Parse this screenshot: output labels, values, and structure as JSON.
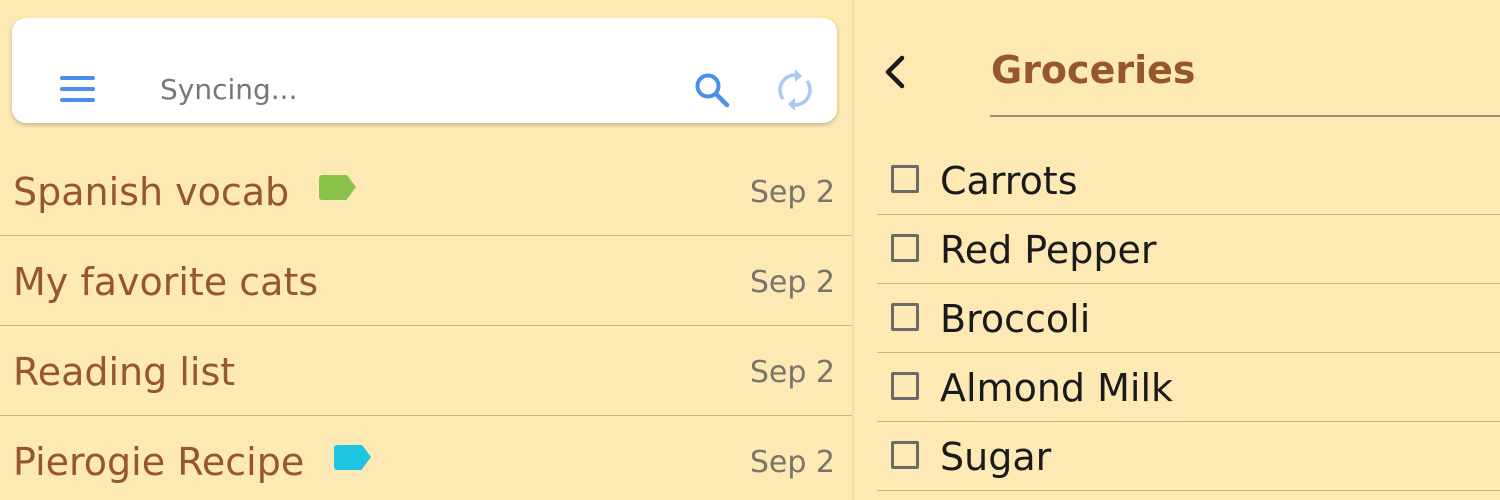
{
  "search_bar": {
    "status_text": "Syncing...",
    "menu_icon": "menu-icon",
    "search_icon": "search-icon",
    "sync_icon": "sync-icon",
    "accent_color": "#4a8ef0"
  },
  "notes": [
    {
      "title": "Spanish vocab",
      "date": "Sep 2",
      "tag_color": "#8bc34a"
    },
    {
      "title": "My favorite cats",
      "date": "Sep 2",
      "tag_color": null
    },
    {
      "title": "Reading list",
      "date": "Sep 2",
      "tag_color": null
    },
    {
      "title": "Pierogie Recipe",
      "date": "Sep 2",
      "tag_color": "#1ec4e0"
    }
  ],
  "detail": {
    "back_icon": "chevron-left-icon",
    "title": "Groceries",
    "items": [
      {
        "label": "Carrots",
        "checked": false
      },
      {
        "label": "Red Pepper",
        "checked": false
      },
      {
        "label": "Broccoli",
        "checked": false
      },
      {
        "label": "Almond Milk",
        "checked": false
      },
      {
        "label": "Sugar",
        "checked": false
      }
    ]
  },
  "colors": {
    "background": "#fde9b3",
    "title_brown": "#96582a",
    "date_gray": "#7a756c"
  }
}
